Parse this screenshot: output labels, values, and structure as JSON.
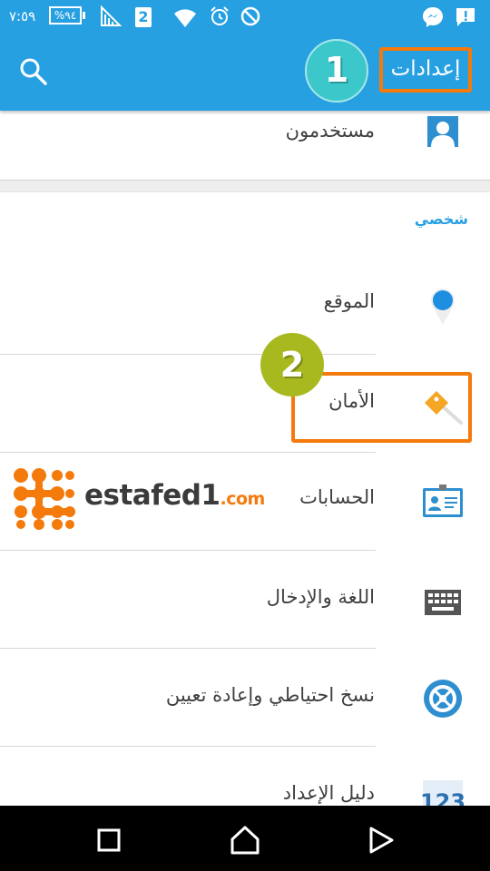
{
  "status_bar": {
    "time": "٧:٥٩",
    "battery": "%٩٤",
    "sim_number": "2",
    "icons": [
      "battery-icon",
      "signal-icon",
      "sim-icon",
      "wifi-icon",
      "alarm-icon",
      "do-not-disturb-icon",
      "messenger-icon",
      "message-alert-icon"
    ]
  },
  "app_bar": {
    "title": "إعدادات",
    "search_icon": "search-icon"
  },
  "annotations": {
    "step1": "1",
    "step2": "2"
  },
  "list": {
    "users_label": "مستخدمون",
    "section_title": "شخصي",
    "items": [
      {
        "label": "الموقع",
        "icon": "location-pin-icon"
      },
      {
        "label": "الأمان",
        "icon": "security-key-icon"
      },
      {
        "label": "الحسابات",
        "icon": "accounts-card-icon"
      },
      {
        "label": "اللغة والإدخال",
        "icon": "keyboard-icon"
      },
      {
        "label": "نسخ احتياطي وإعادة تعيين",
        "icon": "backup-reset-icon"
      },
      {
        "label": "دليل الإعداد",
        "icon": "setup-guide-icon"
      }
    ]
  },
  "watermark": {
    "main": "estafed1",
    "suffix": ".com"
  },
  "colors": {
    "accent": "#27a0e2",
    "highlight_border": "#f47a0c",
    "badge1": "#3cc8cb",
    "badge2": "#a8b920"
  },
  "nav_bar": {
    "icons": [
      "recent-apps-icon",
      "home-icon",
      "back-icon"
    ]
  }
}
